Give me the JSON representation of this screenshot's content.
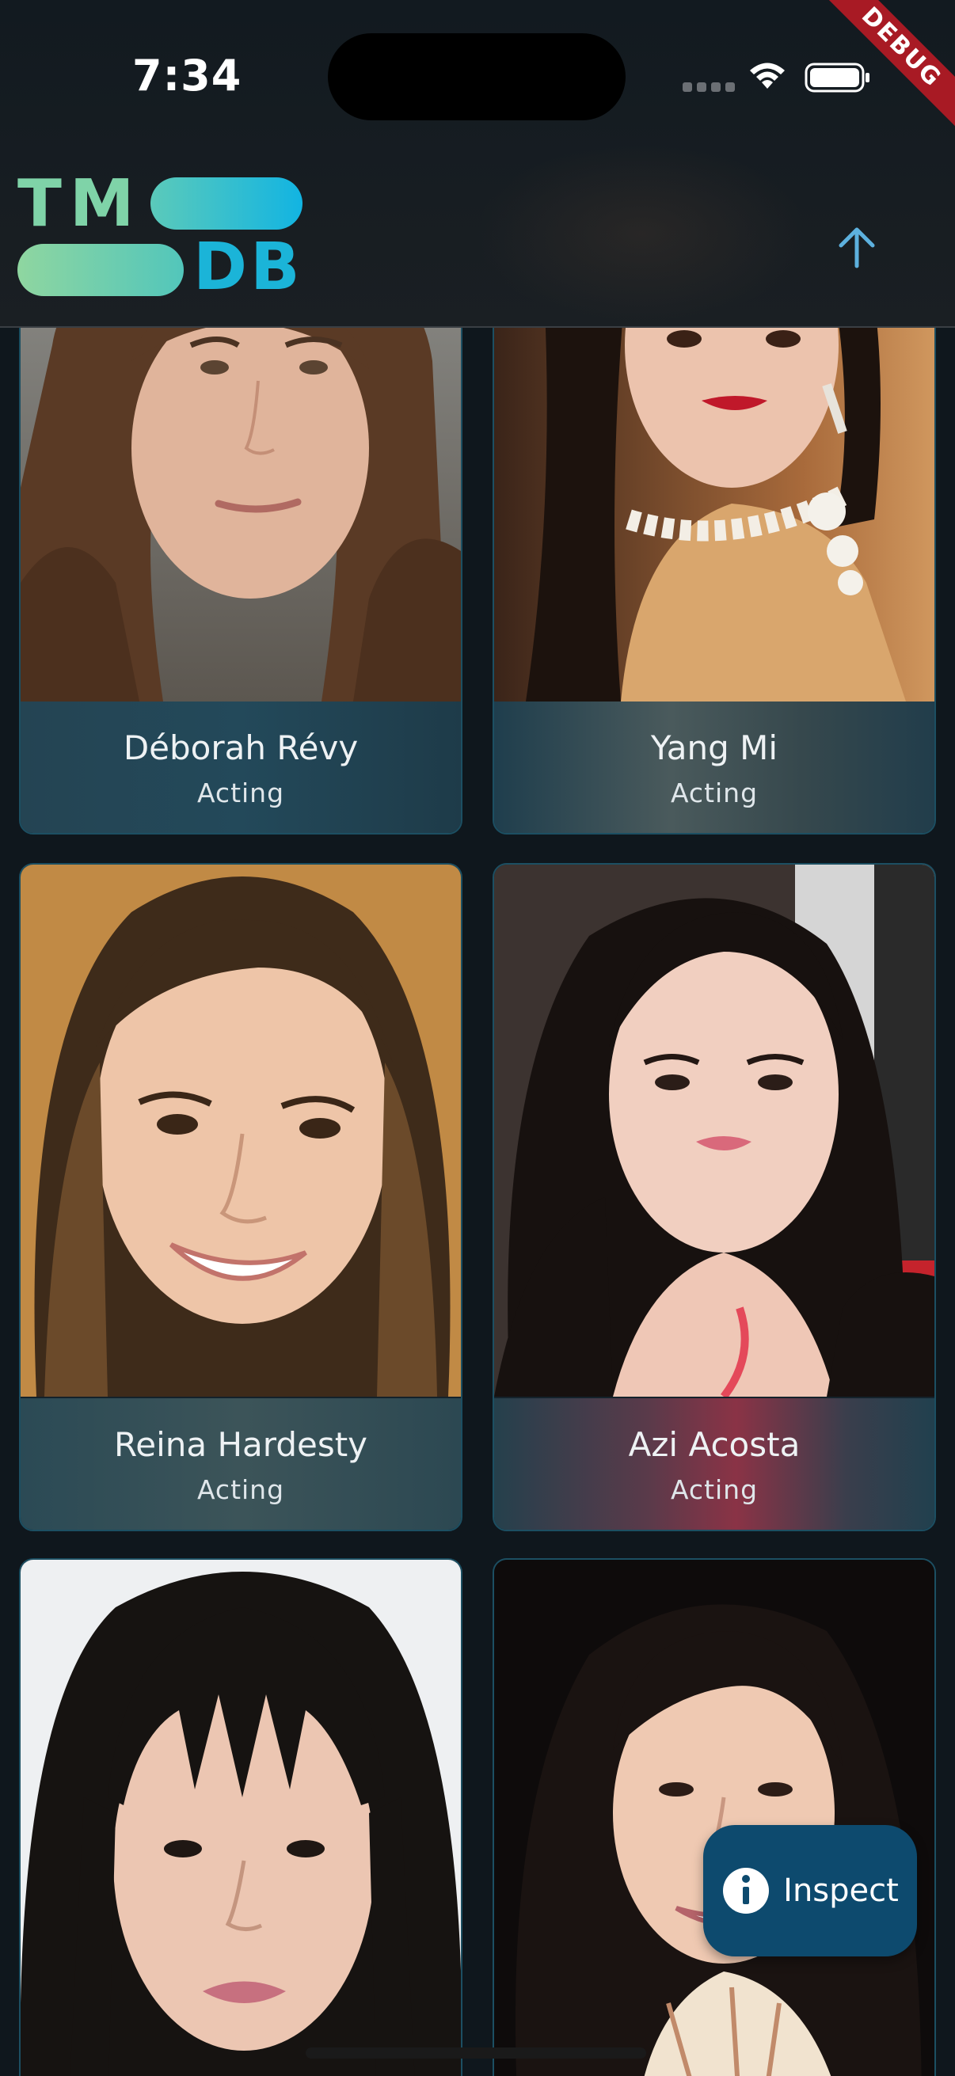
{
  "status_bar": {
    "time": "7:34",
    "debug_banner": "DEBUG"
  },
  "app_bar": {
    "logo_top": "TM",
    "logo_bottom": "DB",
    "scroll_top_icon": "arrow-up-icon"
  },
  "people": [
    {
      "name": "Déborah Révy",
      "department": "Acting"
    },
    {
      "name": "Yang Mi",
      "department": "Acting"
    },
    {
      "name": "Reina Hardesty",
      "department": "Acting"
    },
    {
      "name": "Azi Acosta",
      "department": "Acting"
    },
    {
      "name": "",
      "department": ""
    },
    {
      "name": "",
      "department": ""
    }
  ],
  "inspect_button": {
    "label": "Inspect",
    "icon": "info-icon"
  },
  "colors": {
    "accent_blue": "#1bb4d8",
    "accent_green": "#7fd3a8",
    "card_border": "#1c4f62",
    "inspect_bg": "#0d4a6e"
  }
}
